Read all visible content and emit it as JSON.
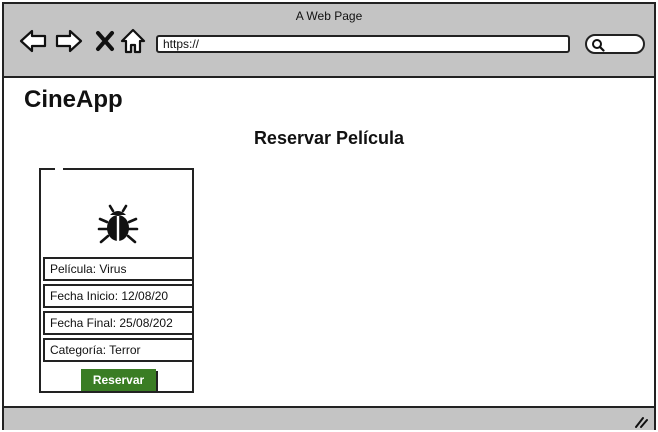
{
  "browser": {
    "window_title": "A Web Page",
    "url": "https://",
    "icons": [
      "back-arrow-icon",
      "forward-arrow-icon",
      "close-x-icon",
      "home-icon",
      "search-icon",
      "resize-grip-icon"
    ]
  },
  "app": {
    "name": "CineApp",
    "page_title": "Reservar Película"
  },
  "card": {
    "icon": "bug-icon",
    "fields": [
      "Película: Virus",
      "Fecha Inicio:  12/08/20",
      "Fecha Final: 25/08/202",
      "Categoría: Terror"
    ],
    "button_label": "Reservar"
  },
  "colors": {
    "chrome": "#c4c4c4",
    "button": "#3a7d24",
    "border": "#222222"
  }
}
